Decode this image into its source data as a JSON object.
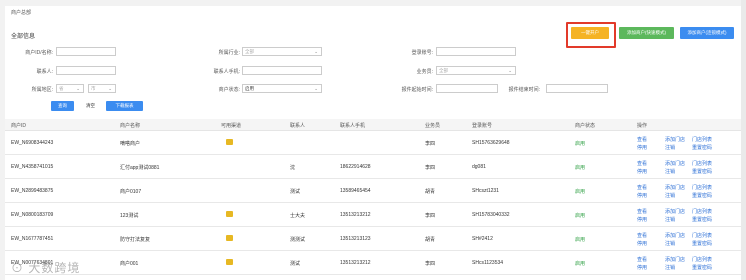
{
  "breadcrumb": "商户总部",
  "section_title": "全部信息",
  "buttons": {
    "one_click": "一键开户",
    "add_store_fast": "添加商户(快速模式)",
    "add_store_pro": "添加商户(连锁模式)",
    "search": "查询",
    "clear": "清空",
    "download": "下载报表"
  },
  "filters": {
    "merchant_id": {
      "label": "商户ID/名称:",
      "value": ""
    },
    "industry": {
      "label": "所属行业:",
      "value": "全部"
    },
    "login_account": {
      "label": "登录账号:",
      "value": ""
    },
    "contact": {
      "label": "联系人:",
      "value": ""
    },
    "contact_phone": {
      "label": "联系人手机:",
      "value": ""
    },
    "salesperson": {
      "label": "业务员:",
      "value": "全部"
    },
    "region": {
      "label": "所属地区:",
      "province": "省",
      "city": "市"
    },
    "status": {
      "label": "商户状态:",
      "value": "启用"
    },
    "start_time": {
      "label": "报件起始时间:",
      "value": ""
    },
    "end_time": {
      "label": "报件结束时间:",
      "value": ""
    }
  },
  "table": {
    "headers": [
      "商户ID",
      "商户名称",
      "可用渠道",
      "联系人",
      "联系人手机",
      "业务员",
      "登录账号",
      "商户状态",
      "操作"
    ],
    "ops": [
      "查看",
      "添加门店",
      "门店列表",
      "停用",
      "注销",
      "重置密码"
    ],
    "rows": [
      {
        "id": "EW_N6908344243",
        "name": "嘀嗒商户",
        "channel": true,
        "contact": "",
        "phone": "",
        "sales": "李四",
        "account": "SH15763629648",
        "status": "启用"
      },
      {
        "id": "EW_N4358741015",
        "name": "汇付app测试0881",
        "channel": false,
        "contact": "沈",
        "phone": "18622914628",
        "sales": "李四",
        "account": "dg081",
        "status": "启用"
      },
      {
        "id": "EW_N2899483875",
        "name": "商户0107",
        "channel": false,
        "contact": "测试",
        "phone": "13589465454",
        "sales": "胡青",
        "account": "SHcszt1231",
        "status": "启用"
      },
      {
        "id": "EW_N0800183709",
        "name": "123测试",
        "channel": true,
        "contact": "士大夫",
        "phone": "13513213212",
        "sales": "李四",
        "account": "SH15783040332",
        "status": "启用"
      },
      {
        "id": "EW_N1677787451",
        "name": "防守打法复复",
        "channel": true,
        "contact": "测测试",
        "phone": "13513213123",
        "sales": "胡青",
        "account": "SH#2412",
        "status": "启用"
      },
      {
        "id": "EW_N0077634801",
        "name": "商户001",
        "channel": true,
        "contact": "测试",
        "phone": "13513213212",
        "sales": "李四",
        "account": "SHcs1123534",
        "status": "启用"
      }
    ]
  },
  "watermark": "大数跨境",
  "colors": {
    "yellow": "#f5b324",
    "green": "#5cb85c",
    "blue": "#3b8cf0",
    "highlight": "#e23a2a",
    "status_green": "#2ea043",
    "link": "#2c6fd6"
  }
}
